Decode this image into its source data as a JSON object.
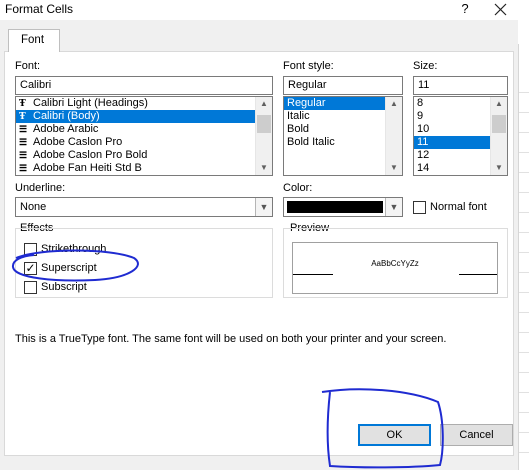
{
  "window": {
    "title": "Format Cells",
    "help_glyph": "?",
    "close_icon": "close-icon"
  },
  "tabs": [
    {
      "label": "Font",
      "active": true
    }
  ],
  "font": {
    "label": "Font:",
    "value": "Calibri",
    "items": [
      "Calibri Light (Headings)",
      "Calibri (Body)",
      "Adobe Arabic",
      "Adobe Caslon Pro",
      "Adobe Caslon Pro Bold",
      "Adobe Fan Heiti Std B"
    ],
    "selected_index": 1
  },
  "font_style": {
    "label": "Font style:",
    "value": "Regular",
    "items": [
      "Regular",
      "Italic",
      "Bold",
      "Bold Italic"
    ],
    "selected_index": 0
  },
  "size": {
    "label": "Size:",
    "value": "11",
    "items": [
      "8",
      "9",
      "10",
      "11",
      "12",
      "14"
    ],
    "selected_index": 3
  },
  "underline": {
    "label": "Underline:",
    "value": "None"
  },
  "color": {
    "label": "Color:",
    "swatch": "#000000"
  },
  "normal_font": {
    "label": "Normal font",
    "checked": false
  },
  "effects": {
    "label": "Effects",
    "strikethrough": {
      "label": "Strikethrough",
      "checked": false
    },
    "superscript": {
      "label": "Superscript",
      "checked": true
    },
    "subscript": {
      "label": "Subscript",
      "checked": false
    }
  },
  "preview": {
    "label": "Preview",
    "sample": "AaBbCcYyZz"
  },
  "info_text": "This is a TrueType font.  The same font will be used on both your printer and your screen.",
  "buttons": {
    "ok": "OK",
    "cancel": "Cancel"
  },
  "annotations": {
    "color": "#1f2bd1"
  }
}
